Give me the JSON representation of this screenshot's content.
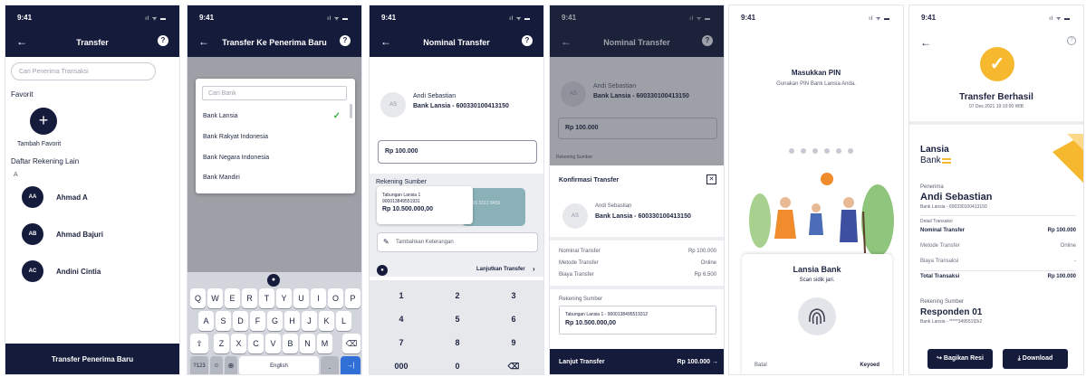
{
  "status_time": "9:41",
  "status_icons": "ıl ᯤ ▬",
  "icons": {
    "back": "←",
    "help": "?",
    "check": "✓",
    "close": "✕",
    "search": "🔍",
    "mic": "🎙",
    "plus": "+"
  },
  "screen1": {
    "title": "Transfer",
    "search_placeholder": "Cari Penerima Transaksi",
    "favorite_label": "Favorit",
    "add_favorite": "Tambah Favorit",
    "other_accounts_label": "Daftar Rekening Lain",
    "letter": "A",
    "contacts": [
      {
        "initials": "AA",
        "name": "Ahmad A"
      },
      {
        "initials": "AB",
        "name": "Ahmad Bajuri"
      },
      {
        "initials": "AC",
        "name": "Andini Cintia"
      }
    ],
    "bottom_button": "Transfer Penerima Baru"
  },
  "screen2": {
    "title": "Transfer Ke Penerima Baru",
    "search_placeholder": "Cari Bank",
    "banks": [
      "Bank Lansia",
      "Bank Rakyat Indonesia",
      "Bank Negara Indonesia",
      "Bank Mandiri"
    ],
    "keyboard_row1": [
      "Q",
      "W",
      "E",
      "R",
      "T",
      "Y",
      "U",
      "I",
      "O",
      "P"
    ],
    "keyboard_row2": [
      "A",
      "S",
      "D",
      "F",
      "G",
      "H",
      "J",
      "K",
      "L"
    ],
    "keyboard_row3": [
      "Z",
      "X",
      "C",
      "V",
      "B",
      "N",
      "M"
    ],
    "key_shift": "⇧",
    "key_delete": "⌫",
    "key_numbers": "?123",
    "key_emoji": "☺",
    "key_globe": "⊕",
    "key_space": "English",
    "key_period": ".",
    "key_enter": "→|"
  },
  "screen3": {
    "title": "Nominal Transfer",
    "recipient_initials": "AS",
    "recipient_name": "Andi Sebastian",
    "recipient_account": "Bank Lansia - 600330100413150",
    "amount": "Rp 100.000",
    "source_label": "Rekening Sumber",
    "source_account_name": "Tabungan Lansia 1",
    "source_account_no": "900013849551931",
    "source_balance": "Rp 10.500.000,00",
    "note_placeholder": "Tambahkan Keterangan",
    "continue_label": "Lanjutkan Transfer",
    "numpad": [
      "1",
      "2",
      "3",
      "4",
      "5",
      "6",
      "7",
      "8",
      "9",
      "000",
      "0",
      "⌫"
    ]
  },
  "screen4": {
    "title": "Nominal Transfer",
    "dialog_title": "Konfirmasi Transfer",
    "recipient_initials": "AS",
    "recipient_name": "Andi Sebastian",
    "recipient_account": "Bank Lansia - 600330100413150",
    "rows": [
      {
        "label": "Nominal Transfer",
        "value": "Rp 100.000"
      },
      {
        "label": "Metode Transfer",
        "value": "Online"
      },
      {
        "label": "Biaya Transfer",
        "value": "Rp 6.500"
      }
    ],
    "source_label": "Rekening Sumber",
    "source_line": "Tabungan Lansia 1 - 9000138495519312",
    "source_balance": "Rp 10.500.000,00",
    "bottom_label": "Lanjut Transfer",
    "bottom_amount": "Rp 100.000 →",
    "bg_amount": "Rp 100.000",
    "bg_source_label": "Rekening Sumber"
  },
  "screen5": {
    "pin_title": "Masukkan PIN",
    "pin_subtitle": "Gunakan PIN Bank Lansia Anda.",
    "pin_dots": 6,
    "sheet_title": "Lansia Bank",
    "sheet_subtitle": "Scan sidik jari.",
    "cancel_label": "Batal",
    "keyword_label": "Keyoed"
  },
  "screen6": {
    "success_title": "Transfer Berhasil",
    "success_date": "07 Des 2021  19:10:00 WIB",
    "brand_line1": "Lansia",
    "brand_line2": "Bank",
    "recipient_label": "Penerima",
    "recipient_name": "Andi Sebastian",
    "recipient_account": "Bank Lansia - 600330100413150",
    "detail_label": "Detail Transaksi",
    "rows": [
      {
        "label": "Nominal Transfer",
        "value": "Rp 100.000",
        "bold": true
      },
      {
        "label": "Metode Transfer",
        "value": "Online",
        "bold": false
      },
      {
        "label": "Biaya Transaksi",
        "value": "-",
        "bold": false
      },
      {
        "label": "Total Transaksi",
        "value": "Rp 100.000",
        "bold": true
      }
    ],
    "source_label": "Rekening Sumber",
    "source_name": "Responden 01",
    "source_account": "Bank Lansia - *****34955193ı2",
    "share_label": "Bagikan Resi",
    "download_label": "Download",
    "share_icon": "↪",
    "download_icon": "⤓"
  },
  "colors": {
    "navy": "#151b3b",
    "green": "#3caa3c",
    "accent": "#f5b82e"
  }
}
